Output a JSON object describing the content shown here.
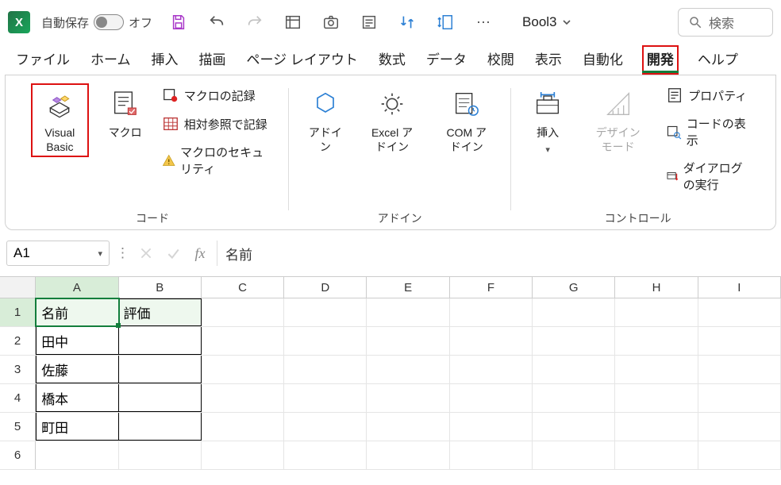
{
  "top": {
    "autosave_label": "自動保存",
    "autosave_state": "オフ",
    "workbook_name": "Bool3",
    "search_placeholder": "検索"
  },
  "tabs": {
    "items": [
      {
        "label": "ファイル"
      },
      {
        "label": "ホーム"
      },
      {
        "label": "挿入"
      },
      {
        "label": "描画"
      },
      {
        "label": "ページ レイアウト"
      },
      {
        "label": "数式"
      },
      {
        "label": "データ"
      },
      {
        "label": "校閲"
      },
      {
        "label": "表示"
      },
      {
        "label": "自動化"
      },
      {
        "label": "開発",
        "active": true,
        "highlighted": true
      },
      {
        "label": "ヘルプ"
      }
    ]
  },
  "ribbon": {
    "groups": {
      "code": {
        "label": "コード",
        "visual_basic": "Visual Basic",
        "macros": "マクロ",
        "record_macro": "マクロの記録",
        "relative_ref": "相対参照で記録",
        "macro_security": "マクロのセキュリティ"
      },
      "addins": {
        "label": "アドイン",
        "addins": "アドイン",
        "excel_addins": "Excel アドイン",
        "com_addins": "COM アドイン"
      },
      "controls": {
        "label": "コントロール",
        "insert": "挿入",
        "design_mode": "デザイン モード",
        "properties": "プロパティ",
        "view_code": "コードの表示",
        "run_dialog": "ダイアログの実行"
      }
    }
  },
  "formula_bar": {
    "name_box": "A1",
    "formula": "名前"
  },
  "sheet": {
    "columns": [
      "A",
      "B",
      "C",
      "D",
      "E",
      "F",
      "G",
      "H",
      "I"
    ],
    "rows": [
      {
        "n": 1,
        "A": "名前",
        "B": "評価"
      },
      {
        "n": 2,
        "A": "田中",
        "B": ""
      },
      {
        "n": 3,
        "A": "佐藤",
        "B": ""
      },
      {
        "n": 4,
        "A": "橋本",
        "B": ""
      },
      {
        "n": 5,
        "A": "町田",
        "B": ""
      },
      {
        "n": 6,
        "A": "",
        "B": ""
      }
    ],
    "data_range": {
      "cols": [
        "A",
        "B"
      ],
      "rows": [
        1,
        5
      ]
    },
    "active_cell": "A1"
  }
}
